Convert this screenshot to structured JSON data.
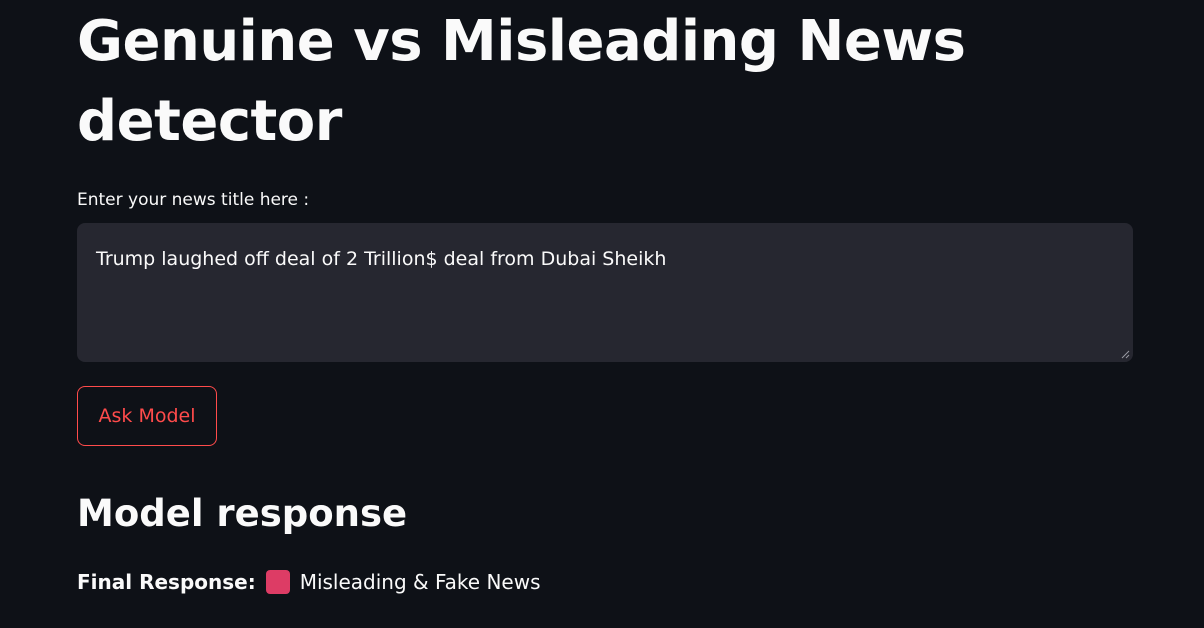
{
  "page": {
    "title": "Genuine vs Misleading News detector"
  },
  "form": {
    "input_label": "Enter your news title here :",
    "input_value": "Trump laughed off deal of 2 Trillion$ deal from Dubai Sheikh",
    "submit_label": "Ask Model"
  },
  "response": {
    "heading": "Model response",
    "final_label": "Final Response:",
    "status_icon": "red-square-icon",
    "status_color": "#dd3c65",
    "result_text": "Misleading & Fake News"
  },
  "colors": {
    "background": "#0e1117",
    "input_background": "#262730",
    "accent": "#ff4b4b",
    "text": "#fafafa"
  }
}
